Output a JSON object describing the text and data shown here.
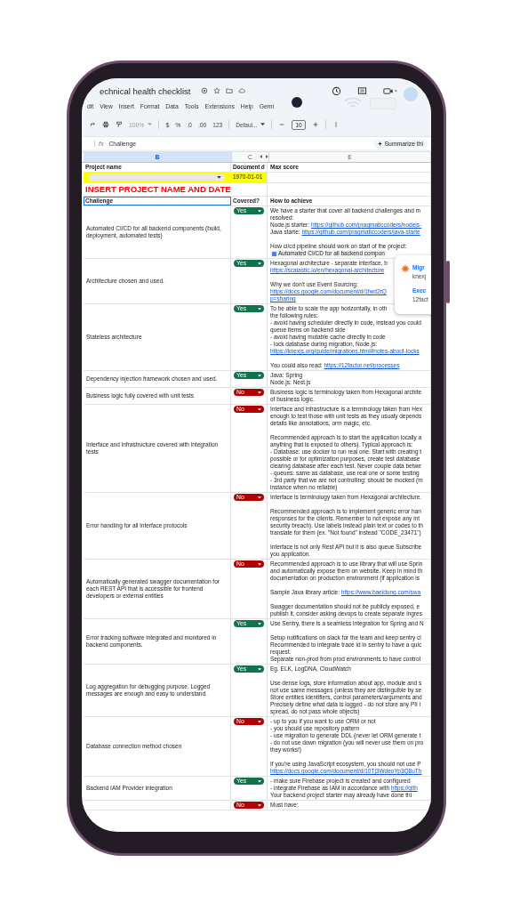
{
  "document": {
    "title": "echnical health checklist"
  },
  "menu": [
    "dit",
    "View",
    "Insert",
    "Format",
    "Data",
    "Tools",
    "Extensions",
    "Help",
    "Gemi"
  ],
  "toolbar": {
    "zoom": "100%",
    "currency": "$",
    "percent": "%",
    "decrease_decimals": ".0",
    "increase_decimals": ".00",
    "number_format": "123",
    "font": "Defaul...",
    "font_size": "10"
  },
  "formula_bar": {
    "fx": "fx",
    "value": "Challenge",
    "summarize_button": "Summarize thi"
  },
  "column_headers": [
    {
      "label": "B",
      "selected": true
    },
    {
      "label": "C",
      "selected": false
    },
    {
      "label": "E",
      "selected": false
    }
  ],
  "header_row": {
    "project_name": "Project name",
    "document_date": "Document d",
    "max_score": "Max score"
  },
  "project_row": {
    "date": "1970-01-01"
  },
  "banner": "INSERT PROJECT NAME AND DATE",
  "table": {
    "columns": [
      {
        "label": "Challenge",
        "selected": true
      },
      {
        "label": "Covered?",
        "selected": false
      },
      {
        "label": "How to achieve",
        "selected": false
      }
    ],
    "rows": [
      {
        "challenge": "Automated CI/CD for all backend components (build, deployment, automated tests)",
        "covered": {
          "label": "Yes",
          "kind": "yes"
        },
        "how": [
          [
            {
              "text": "We have a starter that cover all backend challenges and m"
            },
            {
              "text": "resolved:"
            },
            {
              "text": "Node.js starter: ",
              "link": "https://github.com/pragmaticcoders/nodejs-"
            },
            {
              "text": "Java starte: ",
              "link": "https://github.com/pragmaticcoders/java-starte"
            }
          ],
          [
            {
              "text": "How ci/cd pipeline should work on start of the project:"
            },
            {
              "chip": "Automated CI/CD for all backend compon"
            }
          ]
        ]
      },
      {
        "challenge": "Architecture chosen and used.",
        "covered": {
          "label": "Yes",
          "kind": "yes"
        },
        "how": [
          [
            {
              "text": "Hexagonal architecture - separate interface, b"
            },
            {
              "link": "https://scalastic.io/en/hexagonal-architecture"
            }
          ],
          [
            {
              "text": "Why we don't use Event Sourcing:"
            },
            {
              "link": "https://docs.google.com/document/d/1fwd2rQ"
            },
            {
              "link": "p=sharing"
            }
          ]
        ]
      },
      {
        "challenge": "Stateless architecture",
        "covered": {
          "label": "Yes",
          "kind": "yes"
        },
        "how": [
          [
            {
              "text": "To be able to scale the app horizontally, in oth"
            },
            {
              "text": "the following rules:"
            },
            {
              "text": "- avoid having scheduler directly in code, instead you could"
            },
            {
              "text": "queue items on backend side"
            },
            {
              "text": "- avoid having mutable cache directly in code"
            },
            {
              "text": "- lock database during migration, Node.js:"
            },
            {
              "link": "https://knexjs.org/guide/migrations.html#notes-about-locks"
            }
          ],
          [
            {
              "text": "You could also read: ",
              "link": "https://12factor.net/processes"
            }
          ]
        ]
      },
      {
        "challenge": "Dependency injection framework chosen and used.",
        "covered": {
          "label": "Yes",
          "kind": "yes"
        },
        "how": [
          [
            {
              "text": "Java: Spring"
            },
            {
              "text": "Node.js: Nest.js"
            }
          ]
        ]
      },
      {
        "challenge": "Business logic fully covered with unit tests",
        "covered": {
          "label": "No",
          "kind": "no"
        },
        "how": [
          [
            {
              "text": "Business logic is terminology taken from Hexagonal archite"
            },
            {
              "text": "of business logic."
            }
          ]
        ]
      },
      {
        "challenge": "Interface and infrastructure covered with integration tests",
        "covered": {
          "label": "No",
          "kind": "no"
        },
        "how": [
          [
            {
              "text": "Interface and infrastructure is a terminology taken from Hex"
            },
            {
              "text": "enough to test those with unit tests as they usualy depends"
            },
            {
              "text": "details like annotations, orm magic, etc."
            }
          ],
          [
            {
              "text": "Recommended approach is to start the application locally a"
            },
            {
              "text": "anything that is exposed to others). Typical approach is:"
            },
            {
              "text": "- Database: use docker to run real one. Start with creating t"
            },
            {
              "text": "possible or for optimization purposes, create test database"
            },
            {
              "text": "clearing database after each test. Never couple data betwe"
            },
            {
              "text": "- queues: same as database, use real one or some testing"
            },
            {
              "text": "- 3rd party that we are not controlling: should be mocked (m"
            },
            {
              "text": "instance when no reliable)"
            }
          ]
        ]
      },
      {
        "challenge": "Error handling for all interface protocols",
        "covered": {
          "label": "No",
          "kind": "no"
        },
        "how": [
          [
            {
              "text": "Interface is terminology taken from Hexagonal architecture."
            }
          ],
          [
            {
              "text": "Recommended approach is to implement generic error han"
            },
            {
              "text": "responses for the clients. Remember to not expose any int"
            },
            {
              "text": "security breach). Use labels instead plain text or codes to th"
            },
            {
              "text": "translate for them (ex. \"Not found\" instead \"CODE_23471\")"
            }
          ],
          [
            {
              "text": "Interface is not only Rest API but it is also queue Subscribe"
            },
            {
              "text": "you application."
            }
          ]
        ]
      },
      {
        "challenge": "Automatically generated swagger documentation for each REST API that is accessible for frontend developers or external entities",
        "covered": {
          "label": "No",
          "kind": "no"
        },
        "how": [
          [
            {
              "text": "Recommended approach is to use library that will use Sprin"
            },
            {
              "text": "and automatically expose them on website. Keep in mind th"
            },
            {
              "text": "documentation on production environment (if application is"
            }
          ],
          [
            {
              "text": "Sample Java library article: ",
              "link": "https://www.baeldung.com/swa"
            }
          ],
          [
            {
              "text": "Swagger documentation should not be publicly exposed, e"
            },
            {
              "text": "publish it, consider asking devops to create separate ingres"
            }
          ]
        ]
      },
      {
        "challenge": "Error tracking software integrated and monitored in backend components.",
        "covered": {
          "label": "Yes",
          "kind": "yes"
        },
        "how": [
          [
            {
              "text": "Use Sentry, there is a seamless integration for Spring and N"
            }
          ],
          [
            {
              "text": "Setup notifications on slack for the team and keep sentry cl"
            },
            {
              "text": "Recommended to integrate trace id in sentry to have a quic"
            },
            {
              "text": "request."
            },
            {
              "text": "Separate non-prod from prod environments to have control"
            }
          ]
        ]
      },
      {
        "challenge": "Log aggregation for debugging purpose. Logged messages are enough and easy to understand.",
        "covered": {
          "label": "Yes",
          "kind": "yes"
        },
        "how": [
          [
            {
              "text": "Eg. ELK, LogDNA, CloudWatch"
            }
          ],
          [
            {
              "text": "Use dense logs, store information about app, module and s"
            },
            {
              "text": "not use same messages (unless they are distinguible by se"
            },
            {
              "text": "Store entities identifiers, control parameters/arguments and"
            },
            {
              "text": "Precisely define what data is logged - do not store any PII i"
            },
            {
              "text": "spread, do not pass whole objects)"
            }
          ]
        ]
      },
      {
        "challenge": "Database connection method chosen",
        "covered": {
          "label": "No",
          "kind": "no"
        },
        "how": [
          [
            {
              "text": "- up to you if you want to use ORM or not"
            },
            {
              "text": "- you should use repository pattern"
            },
            {
              "text": "- use migration to generate DDL (never let ORM generate t"
            },
            {
              "text": "- do not use down migration (you will never use them on pro"
            },
            {
              "text": "they works!)"
            }
          ],
          [
            {
              "text": "If you're using JavaScript ecosystem, you should not use P"
            },
            {
              "link": "https://docs.google.com/document/d/10Tj3WdeoYp3Q8uTh"
            }
          ]
        ]
      },
      {
        "challenge": "Backend IAM Provider integration",
        "covered": {
          "label": "Yes",
          "kind": "yes"
        },
        "how": [
          [
            {
              "text": "- make sure Firebase project is created and configured"
            },
            {
              "text": "- integrate Firebase as IAM in accordance with ",
              "link": "https://gith"
            },
            {
              "text": "Your backend project starter may already have done thi"
            }
          ]
        ]
      },
      {
        "covered": {
          "label": "No",
          "kind": "no"
        },
        "how": [
          [
            {
              "text": "Must have:"
            }
          ]
        ]
      }
    ]
  },
  "popup": {
    "items": [
      {
        "icon": true,
        "title": "Migr",
        "subtitle": "knexj"
      },
      {
        "icon": false,
        "title": "Exec",
        "subtitle": "12fact"
      }
    ]
  }
}
